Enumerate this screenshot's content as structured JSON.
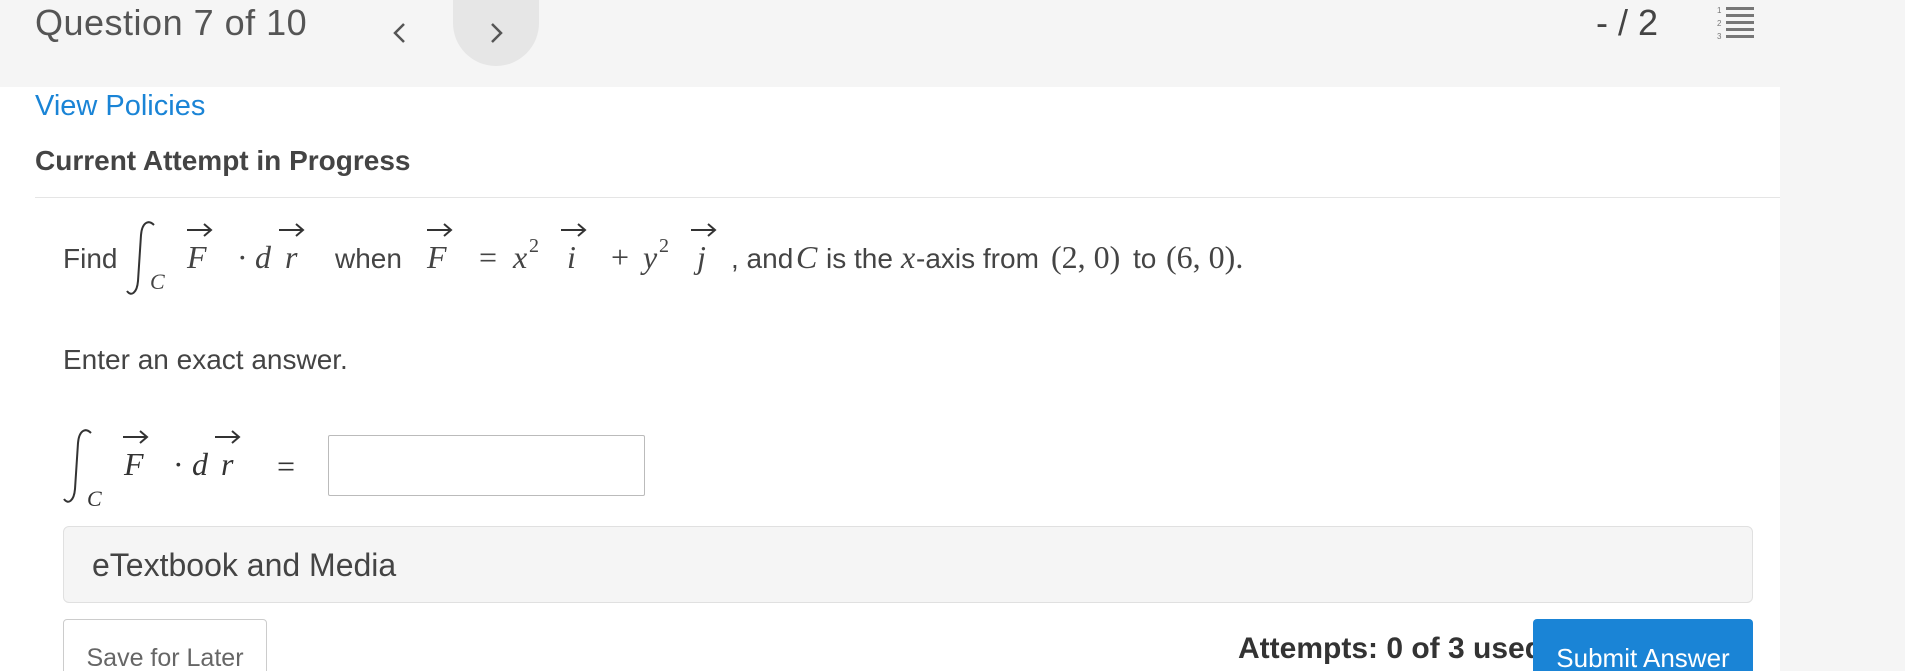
{
  "header": {
    "question_title": "Question 7 of 10",
    "score": "- / 2",
    "prev_icon": "chevron-left-icon",
    "next_icon": "chevron-right-icon",
    "list_icon": "numbered-list-icon"
  },
  "links": {
    "view_policies": "View Policies"
  },
  "attempt_heading": "Current Attempt in Progress",
  "problem": {
    "find": "Find",
    "integral_sub": "C",
    "F": "F",
    "dot": "·",
    "d": "d",
    "r": "r",
    "when": "when",
    "F2": "F",
    "eq": "=",
    "x": "x",
    "x_exp": "2",
    "i": "i",
    "plus": "+",
    "y": "y",
    "y_exp": "2",
    "j": "j",
    "comma_and": ", and",
    "C": "C",
    "is_the": "is the",
    "x2": "x",
    "axis_from": "-axis from",
    "point1": "(2, 0)",
    "to": "to",
    "point2": "(6, 0)."
  },
  "instruction": "Enter an exact answer.",
  "answer": {
    "sub": "C",
    "F": "F",
    "dot": "·",
    "d": "d",
    "r": "r",
    "eq": "=",
    "value": ""
  },
  "etextbook": "eTextbook and Media",
  "footer": {
    "save_label": "Save for Later",
    "attempts_text": "Attempts: 0 of 3 used",
    "submit_label": "Submit Answer"
  },
  "colors": {
    "link": "#1a84d6",
    "submit": "#1a84d6",
    "background": "#f5f5f5"
  }
}
